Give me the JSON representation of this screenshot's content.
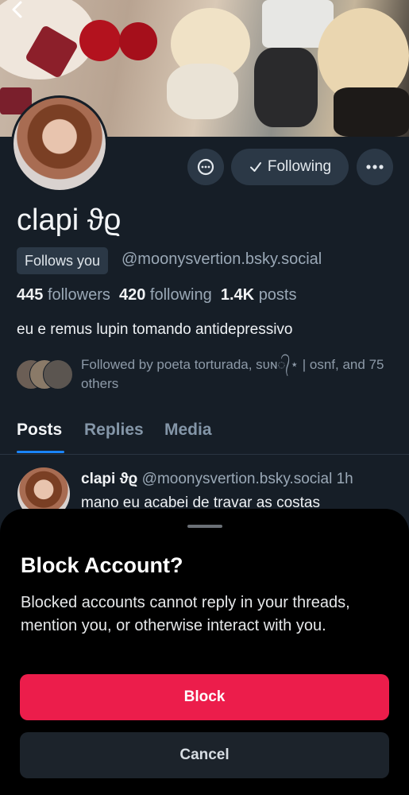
{
  "profile": {
    "display_name": "clapi ϑϱ",
    "follows_you_badge": "Follows you",
    "handle": "@moonysvertion.bsky.social",
    "followers_count": "445",
    "followers_label": "followers",
    "following_count": "420",
    "following_label": "following",
    "posts_count": "1.4K",
    "posts_label": "posts",
    "bio": "eu e remus lupin tomando antidepressivo",
    "known_followers_text": "Followed by poeta torturada, sᴜɴ᭄⋆ | osnf, and 75 others",
    "avatar_icon": "profile-photo"
  },
  "actions": {
    "following_label": "Following",
    "following_icon": "check-icon",
    "message_icon": "chat-bubble-icon",
    "more_icon": "ellipsis-icon"
  },
  "tabs": [
    {
      "label": "Posts",
      "active": true
    },
    {
      "label": "Replies",
      "active": false
    },
    {
      "label": "Media",
      "active": false
    }
  ],
  "post": {
    "author_name": "clapi ϑϱ",
    "author_handle": "@moonysvertion.bsky.social",
    "time": "1h",
    "text": "mano eu acabei de travar as costas"
  },
  "dialog": {
    "title": "Block Account?",
    "description": "Blocked accounts cannot reply in your threads, mention you, or otherwise interact with you.",
    "block_label": "Block",
    "cancel_label": "Cancel"
  },
  "colors": {
    "background": "#161e27",
    "accent": "#1a85ff",
    "danger": "#ec1d4b",
    "sheet": "#000000"
  }
}
